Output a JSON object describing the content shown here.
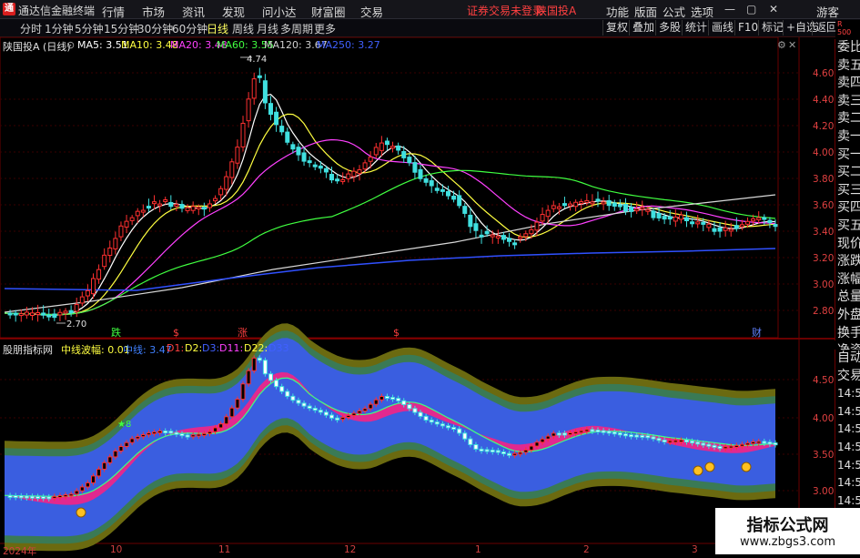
{
  "titlebar": {
    "logo_text": "通",
    "app_title": "通达信金融终端",
    "menu": [
      "行情",
      "市场",
      "资讯",
      "发现",
      "问小达",
      "财富圈",
      "交易"
    ],
    "alert_text": "证券交易未登录",
    "stock_name": "陕国投A",
    "right_menu": [
      "功能",
      "版面",
      "公式",
      "选项"
    ],
    "window_buttons": [
      "—",
      "▢",
      "✕"
    ],
    "guest_label": "游客"
  },
  "toolbar": {
    "periods": [
      "分时",
      "1分钟",
      "5分钟",
      "15分钟",
      "30分钟",
      "60分钟",
      "日线",
      "周线",
      "月线",
      "多周期",
      "更多"
    ],
    "active": "日线",
    "buttons": [
      "复权",
      "叠加",
      "多股",
      "统计",
      "画线",
      "F10",
      "标记",
      "+自选",
      "返回"
    ]
  },
  "main_chart": {
    "stock_label": "陕国投A (日线)",
    "ma": [
      {
        "label": "MA5: 3.51",
        "color": "#ffffff"
      },
      {
        "label": "MA10: 3.48",
        "color": "#ffff40"
      },
      {
        "label": "MA20: 3.48",
        "color": "#ff40ff"
      },
      {
        "label": "MA60: 3.55",
        "color": "#40ff40"
      },
      {
        "label": "MA120: 3.67",
        "color": "#d0d0d0"
      },
      {
        "label": "MA250: 3.27",
        "color": "#4060ff"
      }
    ],
    "high_marker": "4.74",
    "low_marker": "2.70",
    "yaxis": [
      "4.60",
      "4.40",
      "4.20",
      "4.00",
      "3.80",
      "3.60",
      "3.40",
      "3.20",
      "3.00",
      "2.80"
    ],
    "signals": [
      {
        "text": "跌",
        "color": "#40ff40"
      },
      {
        "text": "$",
        "color": "#ff4040"
      },
      {
        "text": "涨",
        "color": "#ff4040"
      },
      {
        "text": "$",
        "color": "#ff4040"
      },
      {
        "text": "财",
        "color": "#6080ff"
      }
    ]
  },
  "sub_chart": {
    "title": "股朋指标网",
    "wave_label": "中线波幅: 0.01",
    "items": [
      {
        "label": "中线: 3.47",
        "color": "#4080ff"
      },
      {
        "label": "D1: ",
        "color": "#ff4040"
      },
      {
        "label": "D2: ",
        "color": "#ffff40"
      },
      {
        "label": "D3: ",
        "color": "#4060ff"
      },
      {
        "label": "D11: ",
        "color": "#ff40ff"
      },
      {
        "label": "D22: ",
        "color": "#ffff40"
      },
      {
        "label": "D33",
        "color": "#4060ff"
      }
    ],
    "star_label": "★8",
    "yaxis": [
      "4.50",
      "4.00",
      "3.50",
      "3.00"
    ]
  },
  "side_panel": {
    "top_labels": [
      "R",
      "500"
    ],
    "items_main": [
      "委比",
      "卖五",
      "卖四",
      "卖三",
      "卖二",
      "卖一",
      "买一",
      "买二",
      "买三",
      "买四",
      "买五",
      "现价",
      "涨跌",
      "涨幅",
      "总量",
      "外盘",
      "换手",
      "净资",
      "收益"
    ],
    "items_sub": [
      "自动",
      "交易",
      "14:56",
      "14:56",
      "14:56",
      "14:56",
      "14:56",
      "14:56",
      "14:56",
      "14:56"
    ]
  },
  "xaxis": [
    "2024年",
    "10",
    "11",
    "12",
    "1",
    "2",
    "3"
  ],
  "watermark": {
    "line1": "指标公式网",
    "line2": "www.zbgs3.com"
  }
}
